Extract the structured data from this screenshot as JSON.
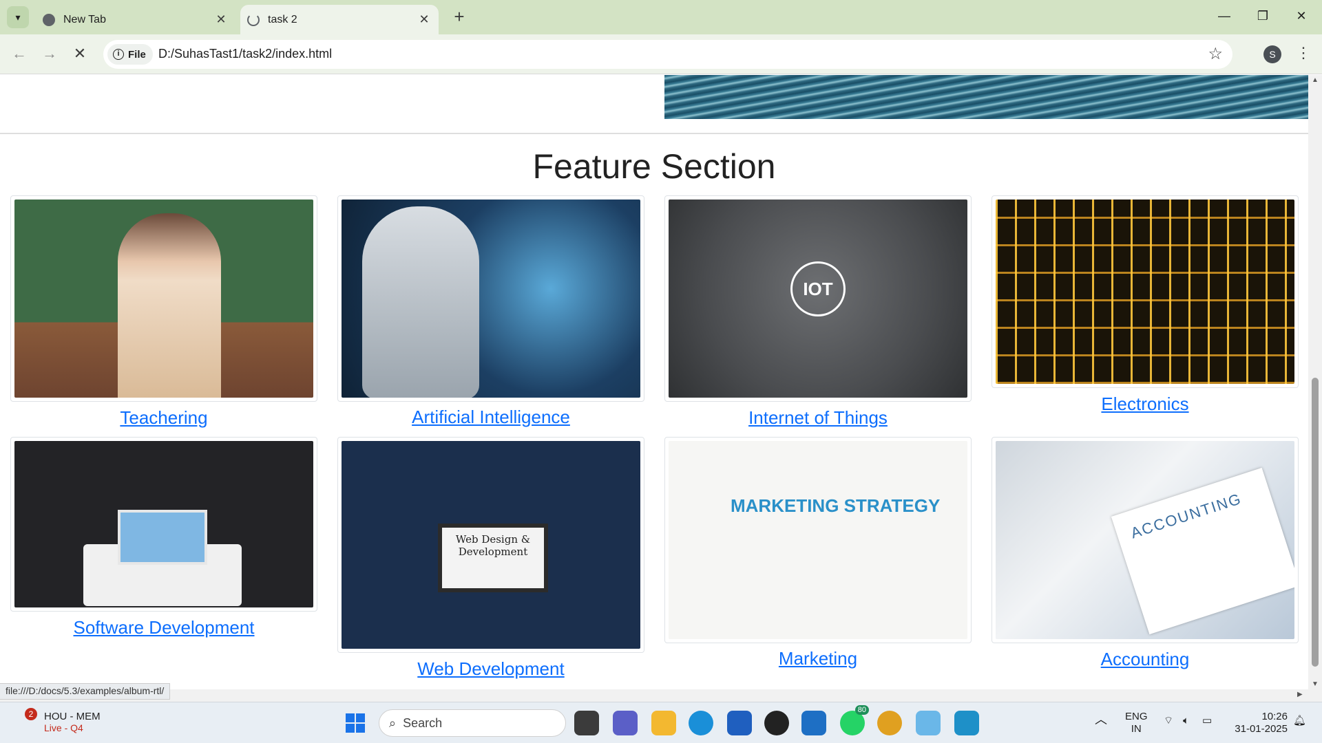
{
  "browser": {
    "tabs": [
      {
        "title": "New Tab",
        "active": false
      },
      {
        "title": "task 2",
        "active": true
      }
    ],
    "new_tab_symbol": "+",
    "chip_label": "File",
    "address": "D:/SuhasTast1/task2/index.html",
    "profile_initial": "S"
  },
  "page": {
    "section_title": "Feature Section",
    "features": [
      {
        "label": "Teachering",
        "image": "teacher-classroom"
      },
      {
        "label": "Artificial Intelligence",
        "image": "robot-network"
      },
      {
        "label": "Internet of Things",
        "image": "iot-hub"
      },
      {
        "label": "Electronics",
        "image": "circuit-board"
      },
      {
        "label": "Software Development",
        "image": "developer-desk"
      },
      {
        "label": "Web Development",
        "image": "web-monitor"
      },
      {
        "label": "Marketing",
        "image": "marketing-strategy"
      },
      {
        "label": "Accounting",
        "image": "accounting-report"
      }
    ],
    "web_monitor_text": "Web Design & Development",
    "iot_text": "IOT",
    "marketing_text": "MARKETING STRATEGY",
    "accounting_text": "ACCOUNTING",
    "link_color": "#0d6efd"
  },
  "status_url": "file:///D:/docs/5.3/examples/album-rtl/",
  "taskbar": {
    "weather_badge": "2",
    "weather_title": "HOU - MEM",
    "weather_sub": "Live - Q4",
    "search_placeholder": "Search",
    "whatsapp_badge": "80",
    "lang_line1": "ENG",
    "lang_line2": "IN",
    "time": "10:26",
    "date": "31-01-2025"
  }
}
